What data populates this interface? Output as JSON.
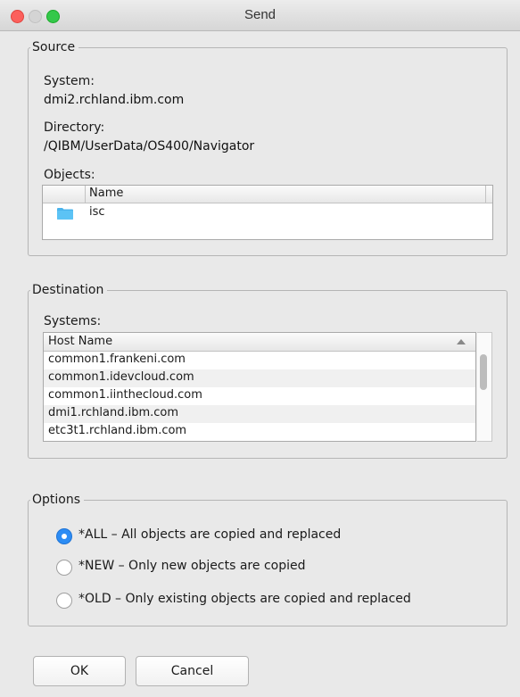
{
  "window": {
    "title": "Send"
  },
  "source": {
    "legend": "Source",
    "system_label": "System:",
    "system_value": "dmi2.rchland.ibm.com",
    "directory_label": "Directory:",
    "directory_value": "/QIBM/UserData/OS400/Navigator",
    "objects_label": "Objects:",
    "objects_columns": [
      "",
      "Name"
    ],
    "objects": [
      {
        "icon": "folder-icon",
        "name": "isc"
      }
    ]
  },
  "destination": {
    "legend": "Destination",
    "systems_label": "Systems:",
    "systems_column": "Host Name",
    "systems": [
      "common1.frankeni.com",
      "common1.idevcloud.com",
      "common1.iinthecloud.com",
      "dmi1.rchland.ibm.com",
      "etc3t1.rchland.ibm.com"
    ]
  },
  "options": {
    "legend": "Options",
    "items": [
      {
        "label": "*ALL – All objects are copied and replaced",
        "checked": true
      },
      {
        "label": "*NEW – Only new objects are copied",
        "checked": false
      },
      {
        "label": "*OLD – Only existing objects are copied and replaced",
        "checked": false
      }
    ]
  },
  "buttons": {
    "ok": "OK",
    "cancel": "Cancel"
  },
  "colors": {
    "radio_selected": "#2c8cf4",
    "folder": "#4ab4ec"
  }
}
